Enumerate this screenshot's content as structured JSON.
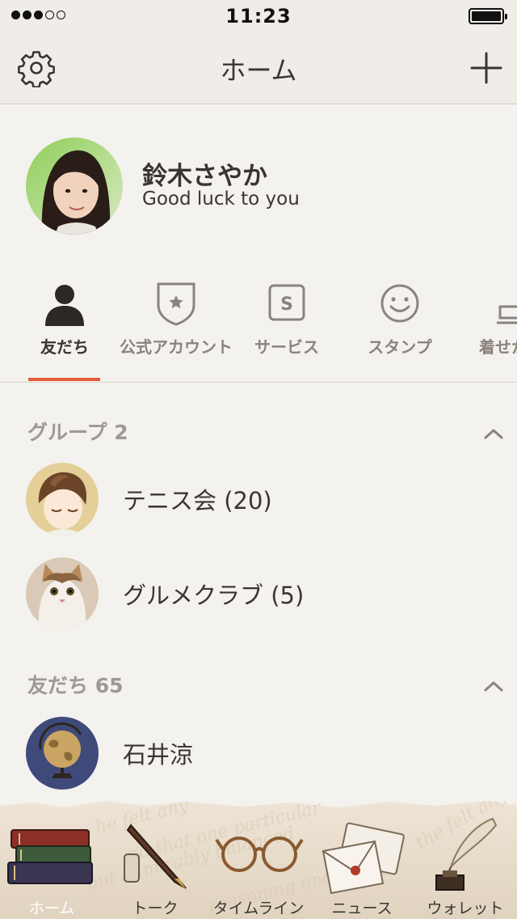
{
  "status_bar": {
    "time": "11:23",
    "signal_bars_filled": 3,
    "signal_bars_total": 5,
    "battery_level": 1.0
  },
  "nav": {
    "title": "ホーム",
    "left_icon": "gear-icon",
    "right_icon": "plus-icon"
  },
  "profile": {
    "name": "鈴木さやか",
    "status": "Good luck to you"
  },
  "tabs": [
    {
      "label": "友だち",
      "icon": "person-icon",
      "active": true
    },
    {
      "label": "公式アカウント",
      "icon": "shield-star-icon",
      "active": false
    },
    {
      "label": "サービス",
      "icon": "s-box-icon",
      "active": false
    },
    {
      "label": "スタンプ",
      "icon": "smiley-icon",
      "active": false
    },
    {
      "label": "着せか",
      "icon": "brush-icon",
      "active": false
    }
  ],
  "groups": {
    "header": "グループ 2",
    "items": [
      {
        "label": "テニス会 (20)"
      },
      {
        "label": "グルメクラブ (5)"
      }
    ]
  },
  "friends": {
    "header": "友だち 65",
    "items": [
      {
        "label": "石井涼"
      }
    ]
  },
  "bottom_tabs": [
    {
      "label": "ホーム",
      "icon": "books-icon",
      "active": true
    },
    {
      "label": "トーク",
      "icon": "fountain-pen-icon",
      "active": false
    },
    {
      "label": "タイムライン",
      "icon": "glasses-icon",
      "active": false
    },
    {
      "label": "ニュース",
      "icon": "envelope-icon",
      "active": false
    },
    {
      "label": "ウォレット",
      "icon": "quill-inkwell-icon",
      "active": false
    }
  ],
  "colors": {
    "accent": "#e25b38",
    "background": "#f4f2ef",
    "header_bg": "#f0ece7",
    "text": "#3b3531",
    "muted": "#a09891"
  }
}
